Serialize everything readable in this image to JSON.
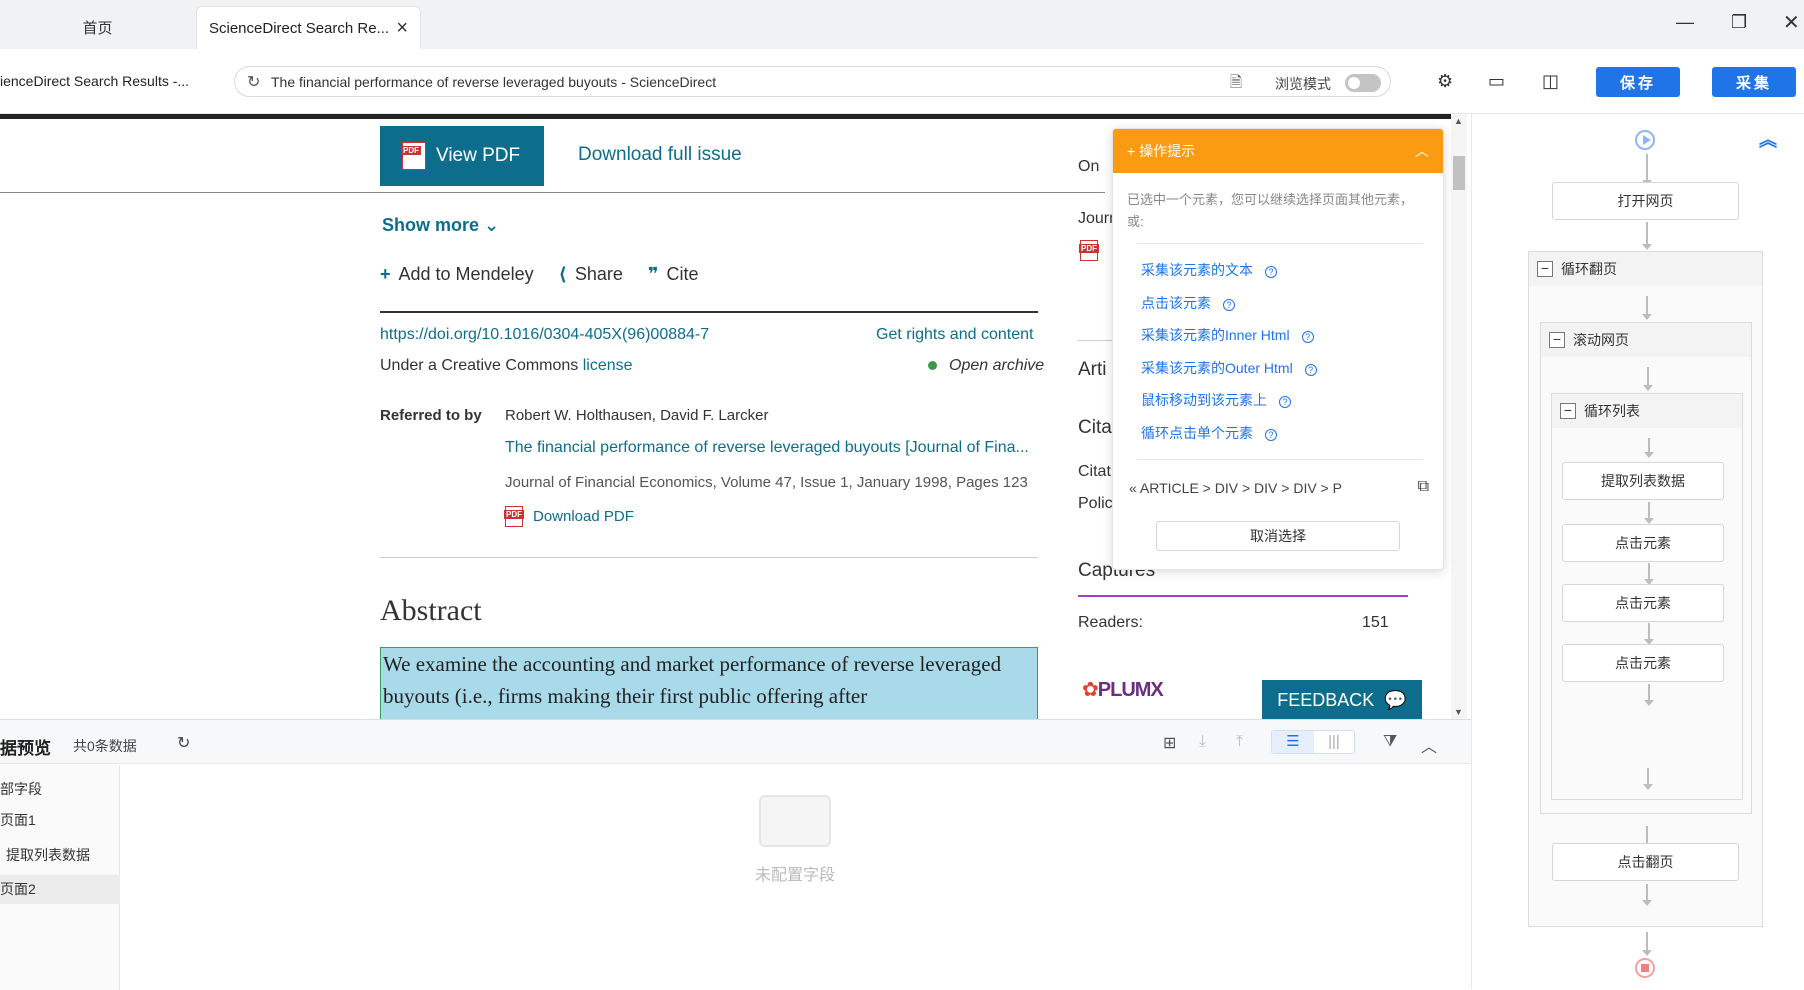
{
  "tabs": [
    {
      "label": "首页",
      "active": false
    },
    {
      "label": "ScienceDirect Search Re...",
      "active": true
    }
  ],
  "address": {
    "prev_tab": "ienceDirect Search Results -...",
    "url": "The financial performance of reverse leveraged buyouts - ScienceDirect",
    "browse_mode_label": "浏览模式",
    "browse_mode_on": false
  },
  "toolbar": {
    "save_label": "保存",
    "collect_label": "采集"
  },
  "article": {
    "view_pdf": "View PDF",
    "download_issue": "Download full issue",
    "show_more": "Show more",
    "add_mendeley": "Add to Mendeley",
    "share": "Share",
    "cite": "Cite",
    "doi": "https://doi.org/10.1016/0304-405X(96)00884-7",
    "rights": "Get rights and content",
    "license_prefix": "Under a Creative Commons",
    "license_link": "license",
    "open_archive": "Open archive",
    "referred_label": "Referred to by",
    "ref_authors": "Robert W. Holthausen, David F. Larcker",
    "ref_title": "The financial performance of reverse leveraged buyouts [Journal of Fina...",
    "ref_journal": "Journal of Financial Economics, Volume 47, Issue 1, January 1998, Pages 123",
    "ref_download": "Download PDF",
    "abstract_heading": "Abstract",
    "abstract_text": "We examine the accounting and market performance of reverse leveraged buyouts (i.e., firms making their first public offering after"
  },
  "right_column": {
    "t1": "On",
    "journ": "Journ",
    "arti": "Arti",
    "cita": "Cita",
    "citat": "Citat",
    "polic": "Polic",
    "captures": "Captures",
    "readers_label": "Readers:",
    "readers_value": "151",
    "plumx": "PLUMX",
    "feedback": "FEEDBACK"
  },
  "hint": {
    "title": "操作提示",
    "desc": "已选中一个元素，您可以继续选择页面其他元素，或:",
    "options": [
      "采集该元素的文本",
      "点击该元素",
      "采集该元素的Inner Html",
      "采集该元素的Outer Html",
      "鼠标移动到该元素上",
      "循环点击单个元素"
    ],
    "crumb": "ARTICLE  >  DIV  >  DIV  >  DIV  >  P",
    "cancel": "取消选择"
  },
  "preview": {
    "title": "据预览",
    "count": "共0条数据",
    "side_items": [
      "部字段",
      "页面1",
      "提取列表数据",
      "页面2"
    ],
    "empty_text": "未配置字段"
  },
  "flow": {
    "open_page": "打开网页",
    "loop_page": "循环翻页",
    "scroll_page": "滚动网页",
    "loop_list": "循环列表",
    "extract_list": "提取列表数据",
    "click1": "点击元素",
    "click2": "点击元素",
    "click3": "点击元素",
    "click_next": "点击翻页"
  },
  "colors": {
    "accent": "#1f74e8",
    "hint_orange": "#fa9b12",
    "sd_blue": "#0c6e8c"
  }
}
